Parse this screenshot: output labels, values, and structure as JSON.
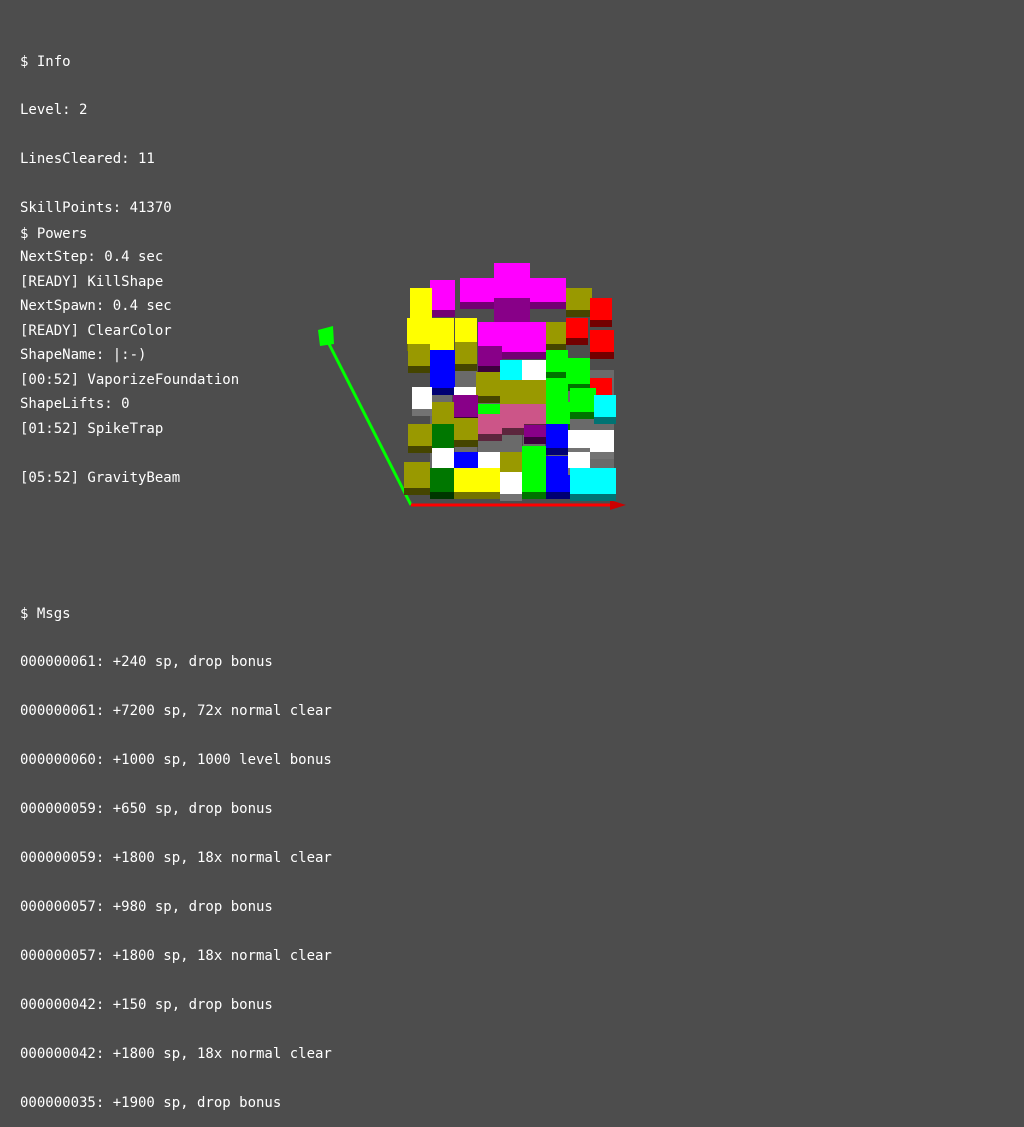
{
  "info": {
    "header": "$ Info",
    "lines": [
      "Level: 2",
      "LinesCleared: 11",
      "SkillPoints: 41370",
      "NextStep: 0.4 sec",
      "NextSpawn: 0.4 sec",
      "ShapeName: |:-)",
      "ShapeLifts: 0"
    ]
  },
  "powers": {
    "header": "$ Powers",
    "lines": [
      "[READY] KillShape",
      "[READY] ClearColor",
      "[00:52] VaporizeFoundation",
      "[01:52] SpikeTrap",
      "[05:52] GravityBeam"
    ]
  },
  "msgs": {
    "header": "$ Msgs",
    "lines": [
      "000000061: +240 sp, drop bonus",
      "000000061: +7200 sp, 72x normal clear",
      "000000060: +1000 sp, 1000 level bonus",
      "000000059: +650 sp, drop bonus",
      "000000059: +1800 sp, 18x normal clear",
      "000000057: +980 sp, drop bonus",
      "000000057: +1800 sp, 18x normal clear",
      "000000042: +150 sp, drop bonus",
      "000000042: +1800 sp, 18x normal clear",
      "000000035: +1900 sp, drop bonus"
    ]
  },
  "colors": {
    "background": "#4d4d4d",
    "text": "#ffffff",
    "axis_y": "#00ff00",
    "axis_x": "#ff0000",
    "axis_z": "#0000ff",
    "magenta": "#ff00ff",
    "yellow": "#ffff00",
    "red": "#ff0000",
    "green": "#00ff00",
    "blue": "#0000ff",
    "cyan": "#00ffff",
    "white": "#ffffff",
    "olive": "#999900",
    "dark_green": "#007700",
    "purple": "#880088",
    "pink": "#cc5588"
  }
}
